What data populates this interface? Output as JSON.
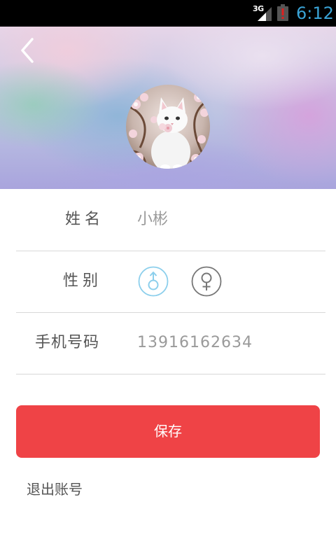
{
  "status_bar": {
    "network": "3G",
    "time": "6:12",
    "icons": [
      "signal-icon",
      "battery-alert-icon"
    ],
    "time_color": "#3aa3d6"
  },
  "header": {
    "back_icon": "chevron-left-icon",
    "avatar_alt": "white kitten with blossoms"
  },
  "profile": {
    "name_label": "姓名",
    "name_value": "小彬",
    "gender_label": "性别",
    "gender_selected": "male",
    "gender_options": [
      {
        "id": "male",
        "icon": "male-icon",
        "color": "#8ccfec"
      },
      {
        "id": "female",
        "icon": "female-icon",
        "color": "#777777"
      }
    ],
    "phone_label": "手机号码",
    "phone_value": "13916162634"
  },
  "actions": {
    "save_label": "保存",
    "logout_label": "退出账号",
    "save_color": "#ef4346"
  }
}
